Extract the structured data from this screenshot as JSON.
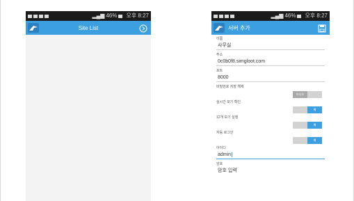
{
  "left_screen": {
    "status": {
      "clock": "오후 8:27",
      "signal_text": "46%"
    },
    "appbar": {
      "title": "Site List"
    }
  },
  "right_screen": {
    "status": {
      "clock": "오후 8:27",
      "signal_text": "46%"
    },
    "appbar": {
      "title": "서버 추가"
    },
    "fields": {
      "name": {
        "label": "이름",
        "value": "사무실"
      },
      "address": {
        "label": "주소",
        "value": "0c0b0f8.simgloot.com"
      },
      "port": {
        "label": "포트",
        "value": "8000"
      },
      "id": {
        "label": "아이디",
        "value": "admin"
      },
      "password": {
        "label": "암호",
        "value": "암호 입력"
      }
    },
    "toggles": [
      {
        "label": "비밀번호 저장 해제",
        "state": "아니오",
        "on": false
      },
      {
        "label": "실시간 보기 확인",
        "state": "예",
        "on": true
      },
      {
        "label": "12개 보기 실행",
        "state": "예",
        "on": true
      },
      {
        "label": "자동 로그인",
        "state": "예",
        "on": true
      }
    ],
    "accent_color": "#3b9fe0"
  }
}
